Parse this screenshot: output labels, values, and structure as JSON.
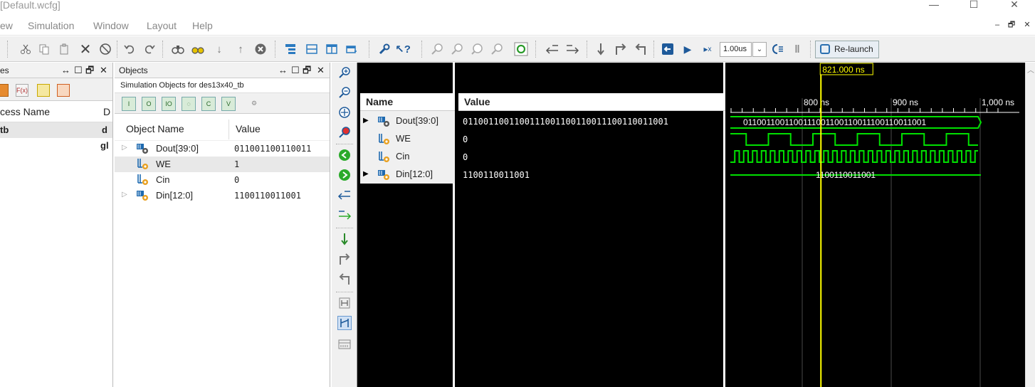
{
  "window": {
    "title": "[Default.wcfg]",
    "min_glyph": "—",
    "max_glyph": "☐",
    "close_glyph": "✕"
  },
  "menu": {
    "items": [
      "ew",
      "Simulation",
      "Window",
      "Layout",
      "Help"
    ],
    "mdi_controls": [
      "–",
      "🗗",
      "✕"
    ]
  },
  "toolbar": {
    "time_value": "1.00us",
    "time_dropdown": "⌄",
    "relaunch_label": "Re-launch"
  },
  "scopes_panel": {
    "title": "es",
    "header_controls": [
      "↔",
      "☐",
      "🗗",
      "✕"
    ],
    "tool_labels": [
      "",
      "F(x)",
      "",
      ""
    ],
    "columns": [
      "cess Name",
      "D"
    ],
    "rows": [
      {
        "name": "tb",
        "d": "d"
      },
      {
        "name": "",
        "d": "gl"
      }
    ]
  },
  "objects_panel": {
    "title": "Objects",
    "header_controls": [
      "↔",
      "☐",
      "🗗",
      "✕"
    ],
    "subtitle": "Simulation Objects for des13x40_tb",
    "columns": {
      "name": "Object Name",
      "value": "Value"
    },
    "rows": [
      {
        "name": "Dout[39:0]",
        "value": "011001100110011",
        "expandable": true,
        "kind": "bus-out",
        "selected": false
      },
      {
        "name": "WE",
        "value": "1",
        "expandable": false,
        "kind": "bit-in",
        "selected": true
      },
      {
        "name": "Cin",
        "value": "0",
        "expandable": false,
        "kind": "bit-in",
        "selected": false
      },
      {
        "name": "Din[12:0]",
        "value": "1100110011001",
        "expandable": true,
        "kind": "bus-in",
        "selected": false
      }
    ]
  },
  "wave": {
    "name_header": "Name",
    "value_header": "Value",
    "cursor_label": "821.000 ns",
    "cursor_time_ns": 821,
    "time_ticks": [
      {
        "label": "800 ns",
        "t": 800
      },
      {
        "label": "900 ns",
        "t": 900
      },
      {
        "label": "1,000 ns",
        "t": 1000
      }
    ],
    "view_start_ns": 720,
    "view_end_ns": 1050,
    "signals": [
      {
        "name": "Dout[39:0]",
        "value": "0110011001100111001100110011100110011001",
        "bus_label": "0110011001100111001100110011100110011001",
        "type": "bus",
        "expandable": true,
        "kind": "bus-out"
      },
      {
        "name": "WE",
        "value": "0",
        "type": "clockish",
        "period_ns": 50,
        "expandable": false,
        "kind": "bit-in"
      },
      {
        "name": "Cin",
        "value": "0",
        "type": "clock",
        "period_ns": 10,
        "expandable": false,
        "kind": "bit-in"
      },
      {
        "name": "Din[12:0]",
        "value": "1100110011001",
        "bus_label": "1100110011001",
        "type": "bus",
        "expandable": true,
        "kind": "bus-in"
      }
    ],
    "colors": {
      "trace": "#00e000",
      "cursor": "#ffff00",
      "grid": "#4a4a4a",
      "bg": "#000000",
      "text": "#ffffff"
    }
  }
}
